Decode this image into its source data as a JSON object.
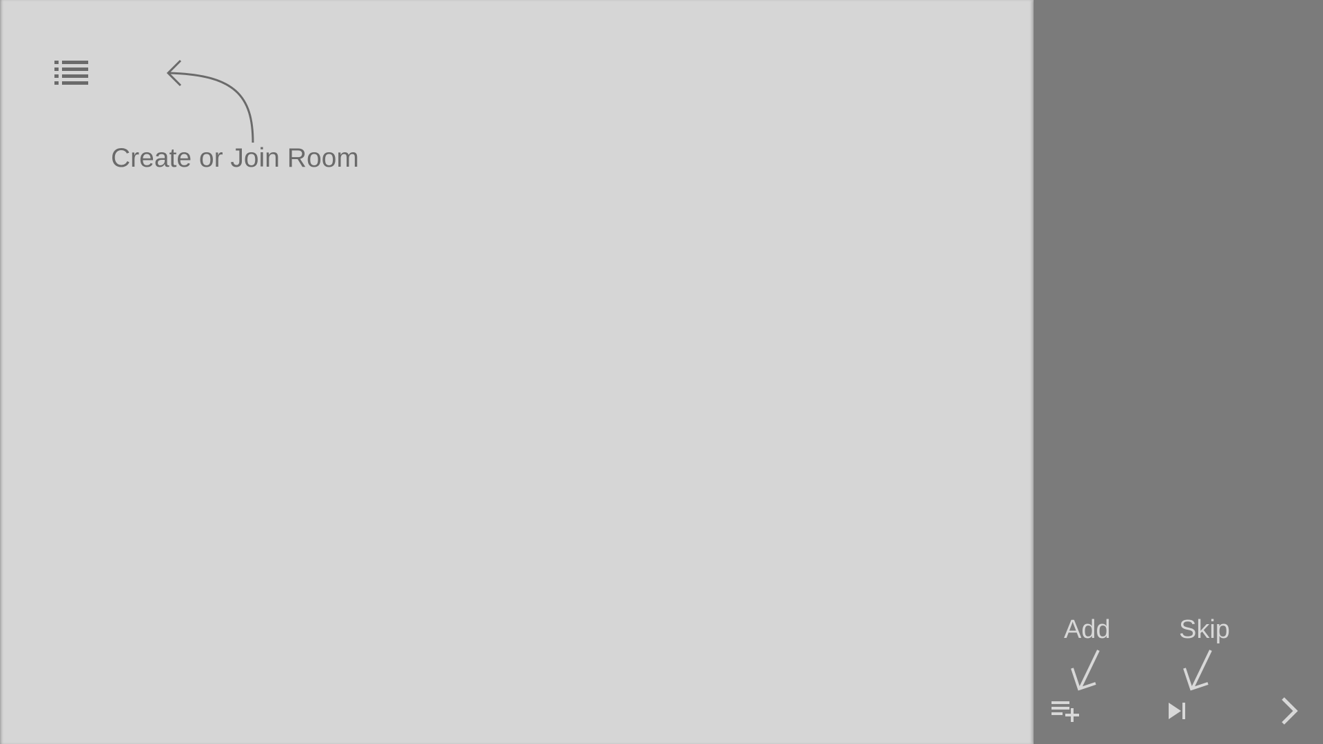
{
  "main": {
    "hint_text": "Create or Join Room",
    "menu_icon": "list-menu-icon"
  },
  "side_panel": {
    "add_hint": "Add",
    "skip_hint": "Skip",
    "add_icon": "playlist-add-icon",
    "skip_icon": "skip-next-icon",
    "next_icon": "chevron-right-icon"
  },
  "colors": {
    "main_background": "#d6d6d6",
    "panel_background": "#7b7b7b",
    "dark_text": "#6a6a6a",
    "light_text": "#d8d8d8"
  }
}
